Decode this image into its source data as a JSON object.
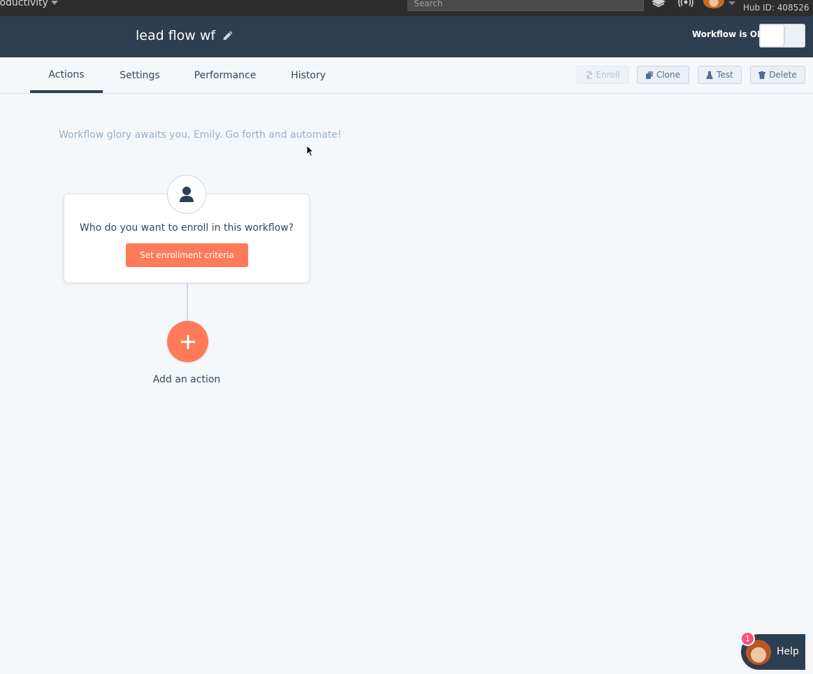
{
  "global_nav": {
    "app_menu_label": "roductivity",
    "search_placeholder": "Search",
    "hub_id": "Hub ID: 408526"
  },
  "workflow_header": {
    "title": "lead flow wf",
    "status": "Workflow is OFF",
    "toggle_on": false
  },
  "tabs": [
    {
      "label": "Actions",
      "active": true
    },
    {
      "label": "Settings",
      "active": false
    },
    {
      "label": "Performance",
      "active": false
    },
    {
      "label": "History",
      "active": false
    }
  ],
  "toolbar": {
    "enroll_label": "Enroll",
    "enroll_disabled": true,
    "clone_label": "Clone",
    "test_label": "Test",
    "delete_label": "Delete"
  },
  "canvas": {
    "greeting": "Workflow glory awaits you, Emily. Go forth and automate!",
    "enrollment_question": "Who do you want to enroll in this workflow?",
    "enrollment_button": "Set enrollment criteria",
    "add_action_label": "Add an action"
  },
  "help_widget": {
    "label": "Help",
    "badge_count": "1"
  },
  "colors": {
    "header_bg": "#2d3e50",
    "accent_orange": "#ff7a59",
    "page_bg": "#f5f8fa",
    "badge_pink": "#f2547d"
  },
  "icons": [
    "caret-down-icon",
    "layers-icon",
    "broadcast-icon",
    "pencil-icon",
    "contact-icon",
    "plus-icon",
    "clone-icon",
    "test-flask-icon",
    "trash-icon",
    "enroll-icon",
    "cursor-icon"
  ]
}
